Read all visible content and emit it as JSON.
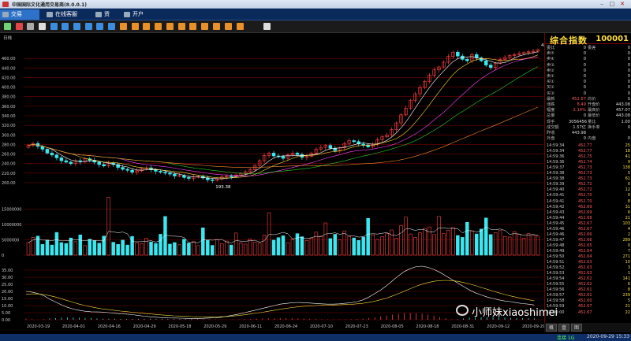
{
  "window": {
    "title": "中国国际文化通用交易商(8.0.0.1)"
  },
  "menu": {
    "tabs": [
      {
        "label": "交易"
      },
      {
        "label": "在线客服"
      },
      {
        "label": "资"
      },
      {
        "label": "开户"
      }
    ]
  },
  "colors": {
    "up": "#ff4040",
    "down": "#39e8f0",
    "ma5": "#ffffff",
    "ma10": "#ffde3a",
    "ma20": "#ff44ff",
    "ma30": "#2ad32a",
    "ma60": "#ff8a2a",
    "grid": "#7a0000"
  },
  "chart": {
    "period_label": "日线",
    "price_labels": [
      "460.00",
      "440.00",
      "420.00",
      "400.00",
      "380.00",
      "360.00",
      "340.00",
      "320.00",
      "300.00",
      "280.00",
      "260.00",
      "240.00",
      "220.00",
      "200.00"
    ],
    "volume_labels": [
      "15000000",
      "10000000",
      "5000000",
      "0"
    ],
    "macd_labels": [
      "35.00",
      "30.00",
      "25.00",
      "20.00",
      "15.00",
      "10.00",
      "5.00",
      "0.00"
    ],
    "date_labels": [
      "2020-03-19",
      "2020-04-01",
      "2020-04-16",
      "2020-04-29",
      "2020-05-18",
      "2020-05-29",
      "2020-06-11",
      "2020-06-24",
      "2020-07-10",
      "2020-07-23",
      "2020-08-05",
      "2020-08-18",
      "2020-08-31",
      "2020-09-12",
      "2020-09-29"
    ],
    "high_annotation": "483",
    "low_annotation": "193.38"
  },
  "chart_data": {
    "type": "candlestick",
    "title": "",
    "x_start": "2020-03-19",
    "x_end": "2020-09-29",
    "ylim": [
      200,
      480
    ],
    "closes": [
      278,
      282,
      276,
      270,
      262,
      258,
      252,
      246,
      243,
      240,
      246,
      244,
      250,
      247,
      243,
      238,
      235,
      241,
      238,
      232,
      228,
      226,
      222,
      225,
      230,
      231,
      227,
      224,
      222,
      220,
      218,
      214,
      215,
      211,
      209,
      212,
      213,
      210,
      206,
      205,
      208,
      212,
      214,
      213,
      216,
      219,
      223,
      227,
      236,
      246,
      257,
      262,
      256,
      255,
      251,
      258,
      262,
      259,
      253,
      255,
      262,
      270,
      274,
      278,
      272,
      267,
      273,
      282,
      288,
      286,
      281,
      279,
      275,
      281,
      290,
      296,
      300,
      311,
      325,
      342,
      356,
      372,
      386,
      399,
      412,
      425,
      436,
      442,
      452,
      464,
      473,
      465,
      458,
      455,
      468,
      461,
      455,
      446,
      441,
      450,
      458,
      462,
      466,
      468,
      470,
      472,
      474,
      475,
      478
    ],
    "volume": [
      4.1,
      5.8,
      6.2,
      3.5,
      4.9,
      3.3,
      7.4,
      4.1,
      3.8,
      5.6,
      4.4,
      6.6,
      3.1,
      5.2,
      4.7,
      3.9,
      6.2,
      18.8,
      4.2,
      3.5,
      4.9,
      3.3,
      6.1,
      4.0,
      3.7,
      5.5,
      4.3,
      3.8,
      6.8,
      12.6,
      3.6,
      4.1,
      3.4,
      5.2,
      3.9,
      4.4,
      3.1,
      8.9,
      4.8,
      3.2,
      5.1,
      3.7,
      4.6,
      3.3,
      7.2,
      4.0,
      3.6,
      5.3,
      4.2,
      3.9,
      6.5,
      13.8,
      4.9,
      5.7,
      6.3,
      4.1,
      5.2,
      7.0,
      6.0,
      4.8,
      5.5,
      7.5,
      6.2,
      10.5,
      5.4,
      6.8,
      5.0,
      7.9,
      6.1,
      5.6,
      4.8,
      5.9,
      12.0,
      6.6,
      5.1,
      6.0,
      7.0,
      8.2,
      5.5,
      9.6,
      12.4,
      6.9,
      5.8,
      7.3,
      8.7,
      9.2,
      6.7,
      12.6,
      7.0,
      8.1,
      9.0,
      6.4,
      5.8,
      10.7,
      7.9,
      6.9,
      8.5,
      12.1,
      6.7,
      7.3,
      8.0,
      6.1,
      5.9,
      7.7,
      6.8,
      5.5,
      7.0,
      6.6,
      6.2
    ],
    "macd_dif": [
      20,
      19.5,
      18.5,
      17,
      14.5,
      12.5,
      10.5,
      8.8,
      7.5,
      6.6,
      6.0,
      5.6,
      5.5,
      5.4,
      5.0,
      4.6,
      4.2,
      4.0,
      3.6,
      3.0,
      2.5,
      2.1,
      1.8,
      1.5,
      1.3,
      1.2,
      1.1,
      1.0,
      0.9,
      0.9,
      1.0,
      1.2,
      1.4,
      1.8,
      2.5,
      3.2,
      4.0,
      5.0,
      6.0,
      7.0,
      8.0,
      9.0,
      10.0,
      11.0,
      11.5,
      12.0,
      12.2,
      12.0,
      11.8,
      11.5,
      11.2,
      11.0,
      11.0,
      11.2,
      11.6,
      12.0,
      12.8,
      14.0,
      16.0,
      18.5,
      21.0,
      24.0,
      27.5,
      31.0,
      34.0,
      36.0,
      37.5,
      37.8,
      37.0,
      35.5,
      33.5,
      31.0,
      28.5,
      26.0,
      23.5,
      21.0,
      19.0,
      17.5,
      16.0,
      15.0,
      14.0,
      13.2,
      12.8,
      12.0,
      11.4,
      11.0,
      10.4
    ],
    "macd_dea": [
      18,
      18.2,
      18.2,
      17.8,
      17.0,
      16.0,
      14.8,
      13.5,
      12.2,
      11.0,
      10.0,
      9.1,
      8.3,
      7.6,
      7.1,
      6.6,
      6.1,
      5.7,
      5.3,
      4.9,
      4.5,
      4.1,
      3.7,
      3.4,
      3.1,
      2.8,
      2.6,
      2.4,
      2.2,
      2.0,
      1.9,
      1.9,
      2.0,
      2.1,
      2.3,
      2.6,
      3.0,
      3.5,
      4.1,
      4.7,
      5.3,
      6.0,
      6.7,
      7.4,
      8.0,
      8.6,
      9.1,
      9.5,
      9.8,
      10.0,
      10.2,
      10.3,
      10.4,
      10.5,
      10.7,
      10.9,
      11.2,
      11.6,
      12.3,
      13.1,
      14.1,
      15.3,
      16.8,
      18.4,
      20.1,
      21.9,
      23.6,
      25.1,
      26.2,
      27.1,
      27.6,
      27.8,
      27.6,
      27.1,
      26.3,
      25.3,
      24.1,
      22.8,
      21.5,
      20.2,
      19.0,
      17.8,
      16.8,
      15.8,
      14.9,
      14.1,
      13.3
    ]
  },
  "index_panel": {
    "title": "综合指数",
    "code": "100001",
    "rows": [
      {
        "l": "委比",
        "v1": "0",
        "l2": "委差",
        "v2": "0"
      },
      {
        "l": "卖⑤",
        "v1": "0",
        "l2": "",
        "v2": "0"
      },
      {
        "l": "卖④",
        "v1": "0",
        "l2": "",
        "v2": "0"
      },
      {
        "l": "卖③",
        "v1": "0",
        "l2": "",
        "v2": "0"
      },
      {
        "l": "卖②",
        "v1": "0",
        "l2": "",
        "v2": "0"
      },
      {
        "l": "卖①",
        "v1": "0",
        "l2": "",
        "v2": "0"
      },
      {
        "l": "买①",
        "v1": "0",
        "l2": "",
        "v2": "0"
      },
      {
        "l": "买②",
        "v1": "0",
        "l2": "",
        "v2": "0"
      },
      {
        "l": "买③",
        "v1": "0",
        "l2": "",
        "v2": "0"
      },
      {
        "l": "最新",
        "v1": "452.67",
        "l2": "均价",
        "v2": "0"
      },
      {
        "l": "涨跌",
        "v1": "8.49",
        "l2": "开盘价",
        "v2": "443.08"
      },
      {
        "l": "幅度",
        "v1": "2.14%",
        "l2": "最高价",
        "v2": "457.07"
      },
      {
        "l": "总量",
        "v1": "0",
        "l2": "最低价",
        "v2": "443.08"
      },
      {
        "l": "现手",
        "v1": "3056456",
        "l2": "量比",
        "v2": "1.00"
      },
      {
        "l": "成交额",
        "v1": "1.57亿",
        "l2": "换手率",
        "v2": "0"
      },
      {
        "l": "昨收",
        "v1": "443.98",
        "l2": "",
        "v2": ""
      },
      {
        "l": "外盘",
        "v1": "0",
        "l2": "内盘",
        "v2": "0"
      }
    ],
    "ticks": [
      {
        "t": "14:59:34",
        "p": "452.77",
        "v": "25"
      },
      {
        "t": "14:59:34",
        "p": "452.77",
        "v": "18"
      },
      {
        "t": "14:59:36",
        "p": "452.75",
        "v": "41"
      },
      {
        "t": "14:59:36",
        "p": "452.74",
        "v": "9"
      },
      {
        "t": "14:59:37",
        "p": "452.73",
        "v": "138"
      },
      {
        "t": "14:59:38",
        "p": "452.73",
        "v": "5"
      },
      {
        "t": "14:59:38",
        "p": "452.73",
        "v": "61"
      },
      {
        "t": "14:59:39",
        "p": "452.72",
        "v": "0"
      },
      {
        "t": "14:59:40",
        "p": "452.72",
        "v": "12"
      },
      {
        "t": "14:59:41",
        "p": "452.70",
        "v": "0"
      },
      {
        "t": "14:59:41",
        "p": "452.70",
        "v": "8"
      },
      {
        "t": "14:59:42",
        "p": "452.69",
        "v": "31"
      },
      {
        "t": "14:59:43",
        "p": "452.69",
        "v": "6"
      },
      {
        "t": "14:59:44",
        "p": "452.68",
        "v": "21"
      },
      {
        "t": "14:59:45",
        "p": "452.67",
        "v": "103"
      },
      {
        "t": "14:59:46",
        "p": "452.67",
        "v": "4"
      },
      {
        "t": "14:59:46",
        "p": "452.66",
        "v": "2"
      },
      {
        "t": "14:59:47",
        "p": "452.66",
        "v": "289"
      },
      {
        "t": "14:59:48",
        "p": "452.65",
        "v": "0"
      },
      {
        "t": "14:59:49",
        "p": "452.64",
        "v": "7"
      },
      {
        "t": "14:59:50",
        "p": "452.64",
        "v": "271"
      },
      {
        "t": "14:59:51",
        "p": "452.63",
        "v": "10"
      },
      {
        "t": "14:59:52",
        "p": "452.63",
        "v": "3"
      },
      {
        "t": "14:59:53",
        "p": "452.63",
        "v": "1"
      },
      {
        "t": "14:59:54",
        "p": "452.62",
        "v": "141"
      },
      {
        "t": "14:59:55",
        "p": "452.62",
        "v": "6"
      },
      {
        "t": "14:59:56",
        "p": "452.61",
        "v": "8"
      },
      {
        "t": "14:59:57",
        "p": "452.61",
        "v": "239"
      },
      {
        "t": "14:59:58",
        "p": "452.60",
        "v": "5"
      },
      {
        "t": "14:59:59",
        "p": "452.67",
        "v": "21"
      },
      {
        "t": "15:00:00",
        "p": "452.67",
        "v": "22"
      }
    ]
  },
  "bottom_tabs": [
    {
      "label": "概"
    },
    {
      "label": "盘"
    },
    {
      "label": "图"
    }
  ],
  "status": {
    "left": "连接 1G",
    "right": "2020-09-29 15:33"
  },
  "watermark": {
    "text": "小师妹xiaoshimei"
  }
}
